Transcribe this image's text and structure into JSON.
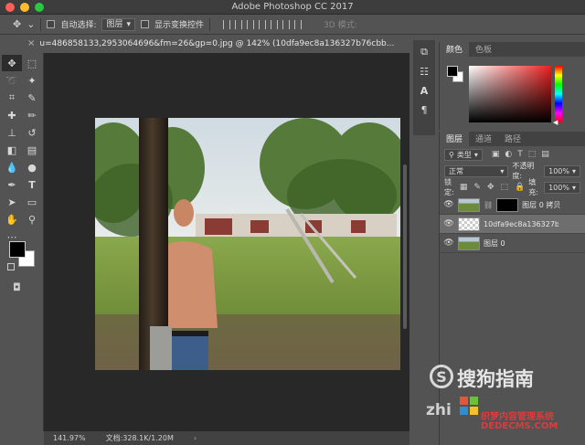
{
  "window": {
    "title": "Adobe Photoshop CC 2017",
    "traffic_colors": [
      "#ff5f57",
      "#febc2e",
      "#28c840"
    ]
  },
  "options_bar": {
    "auto_select_label": "自动选择:",
    "auto_select_value": "图层",
    "show_transform_label": "显示变换控件",
    "mode_3d_label": "3D 模式:"
  },
  "document_tab": {
    "title": "u=486858133,2953064696&fm=26&gp=0.jpg @ 142% (10dfa9ec8a136327b76cbb..."
  },
  "status_bar": {
    "zoom": "141.97%",
    "doc_info": "文档:328.1K/1.20M"
  },
  "panels": {
    "color_tabs": [
      "颜色",
      "色板"
    ],
    "layers_tabs": [
      "图层",
      "通道",
      "路径"
    ],
    "filter_label": "类型",
    "blend_mode": "正常",
    "opacity_label": "不透明度:",
    "opacity_value": "100%",
    "lock_label": "锁定:",
    "fill_label": "填充:",
    "fill_value": "100%",
    "layers": [
      {
        "name": "图层 0 拷贝"
      },
      {
        "name": "10dfa9ec8a136327b7..."
      },
      {
        "name": "图层 0"
      }
    ]
  },
  "watermark": {
    "logo_glyph": "S",
    "brand": "搜狗指南",
    "partial": "zhi",
    "site_cn": "织梦内容管理系统",
    "site_url": "DEDECMS.COM"
  }
}
